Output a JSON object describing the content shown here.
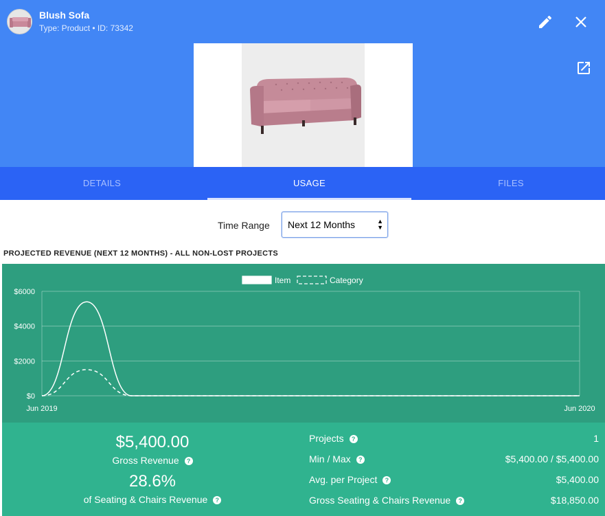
{
  "header": {
    "title": "Blush Sofa",
    "subtitle": "Type: Product • ID: 73342"
  },
  "icons": {
    "edit": "pencil-icon",
    "close": "close-icon",
    "open": "open-in-new-icon"
  },
  "tabs": [
    {
      "label": "DETAILS",
      "active": false
    },
    {
      "label": "USAGE",
      "active": true
    },
    {
      "label": "FILES",
      "active": false
    }
  ],
  "time_range": {
    "label": "Time Range",
    "selected": "Next 12 Months"
  },
  "section_title": "PROJECTED REVENUE (NEXT 12 MONTHS) - ALL NON-LOST PROJECTS",
  "colors": {
    "header": "#4286f5",
    "tabs": "#2b63f5",
    "chart_bg": "#2e9e7f",
    "stats_bg": "#30b38f"
  },
  "chart_data": {
    "type": "line",
    "title": "",
    "xlabel": "",
    "ylabel": "",
    "ylim": [
      0,
      6000
    ],
    "yticks": [
      "$0",
      "$2000",
      "$4000",
      "$6000"
    ],
    "ytick_values": [
      0,
      2000,
      4000,
      6000
    ],
    "xticks": [
      "Jun 2019",
      "Jun 2020"
    ],
    "legend_placement": "top-center",
    "grid": true,
    "x": [
      "2019-06",
      "2019-07",
      "2019-08",
      "2019-09",
      "2019-10",
      "2019-11",
      "2019-12",
      "2020-01",
      "2020-02",
      "2020-03",
      "2020-04",
      "2020-05",
      "2020-06"
    ],
    "series": [
      {
        "name": "Item",
        "style": "solid",
        "values": [
          0,
          5400,
          0,
          0,
          0,
          0,
          0,
          0,
          0,
          0,
          0,
          0,
          0
        ]
      },
      {
        "name": "Category",
        "style": "dashed",
        "values": [
          0,
          1500,
          0,
          0,
          0,
          0,
          0,
          0,
          0,
          0,
          0,
          0,
          0
        ]
      }
    ]
  },
  "stats": {
    "gross_revenue_value": "$5,400.00",
    "gross_revenue_label": "Gross Revenue",
    "share_value": "28.6%",
    "share_label": "of Seating & Chairs Revenue",
    "rows": [
      {
        "name": "Projects",
        "value": "1"
      },
      {
        "name": "Min / Max",
        "value": "$5,400.00 / $5,400.00"
      },
      {
        "name": "Avg. per Project",
        "value": "$5,400.00"
      },
      {
        "name": "Gross Seating & Chairs Revenue",
        "value": "$18,850.00"
      }
    ]
  }
}
